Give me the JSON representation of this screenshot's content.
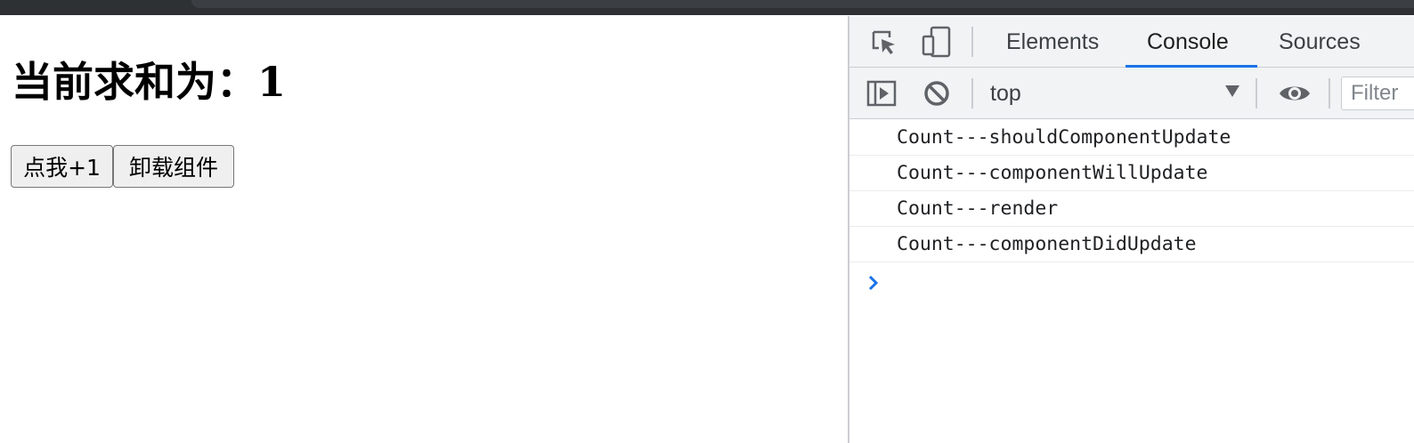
{
  "page": {
    "heading": "当前求和为：1",
    "buttons": {
      "increment_label": "点我+1",
      "unmount_label": "卸载组件"
    }
  },
  "devtools": {
    "tabs": [
      {
        "label": "Elements",
        "active": false
      },
      {
        "label": "Console",
        "active": true
      },
      {
        "label": "Sources",
        "active": false
      }
    ],
    "toolbar": {
      "context": "top",
      "filter_placeholder": "Filter"
    },
    "console_messages": [
      "Count---shouldComponentUpdate",
      "Count---componentWillUpdate",
      "Count---render",
      "Count---componentDidUpdate"
    ],
    "icons": [
      "inspect-element-icon",
      "device-toolbar-icon",
      "sidebar-toggle-icon",
      "clear-console-icon",
      "live-expression-eye-icon",
      "prompt-chevron-icon"
    ],
    "colors": {
      "accent": "#1a73e8",
      "toolbar_bg": "#f1f3f4",
      "text": "#202124"
    }
  }
}
